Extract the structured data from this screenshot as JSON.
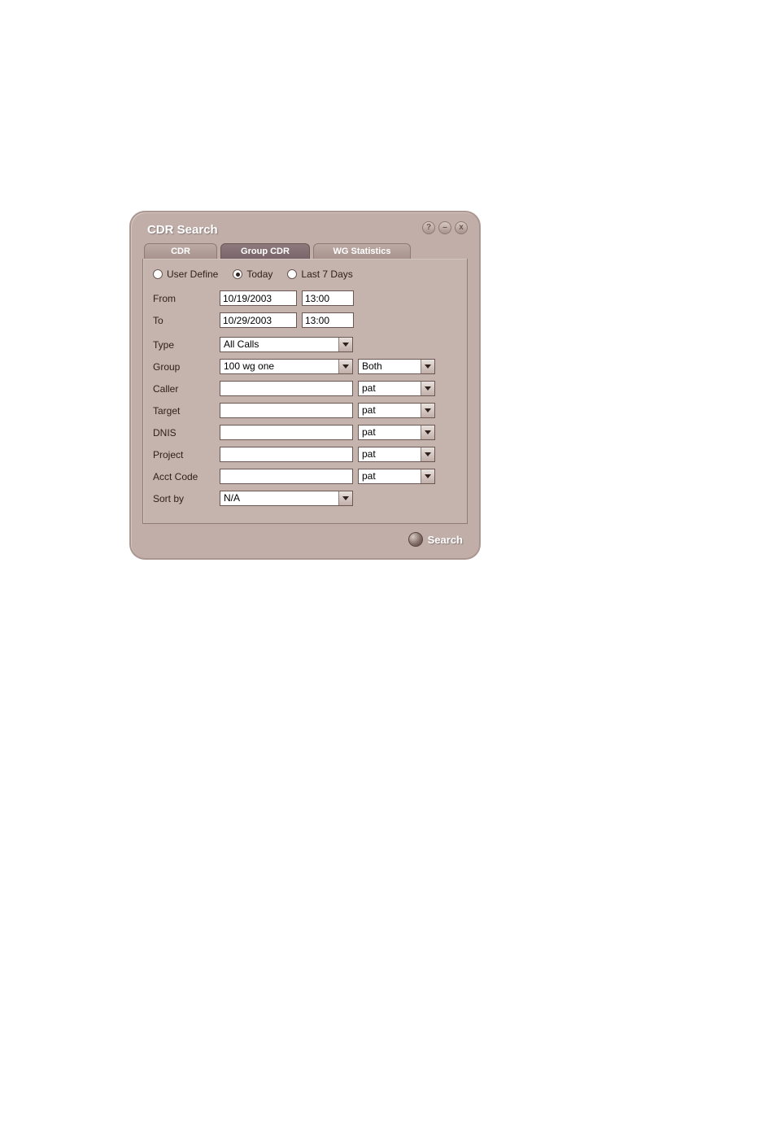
{
  "window": {
    "title": "CDR Search"
  },
  "controls": {
    "help": "?",
    "minimize": "–",
    "close": "x"
  },
  "tabs": {
    "cdr": "CDR",
    "group_cdr": "Group CDR",
    "wg_stats": "WG Statistics"
  },
  "radios": {
    "user_define": "User Define",
    "today": "Today",
    "last7": "Last 7 Days"
  },
  "labels": {
    "from": "From",
    "to": "To",
    "type": "Type",
    "group": "Group",
    "caller": "Caller",
    "target": "Target",
    "dnis": "DNIS",
    "project": "Project",
    "acct": "Acct Code",
    "sort": "Sort by"
  },
  "values": {
    "from_date": "10/19/2003",
    "from_time": "13:00",
    "to_date": "10/29/2003",
    "to_time": "13:00",
    "type": "All Calls",
    "group": "100   wg one",
    "group_side": "Both",
    "caller": "",
    "caller_side": "pat",
    "target": "",
    "target_side": "pat",
    "dnis": "",
    "dnis_side": "pat",
    "project": "",
    "project_side": "pat",
    "acct": "",
    "acct_side": "pat",
    "sort": "N/A"
  },
  "footer": {
    "search": "Search"
  }
}
